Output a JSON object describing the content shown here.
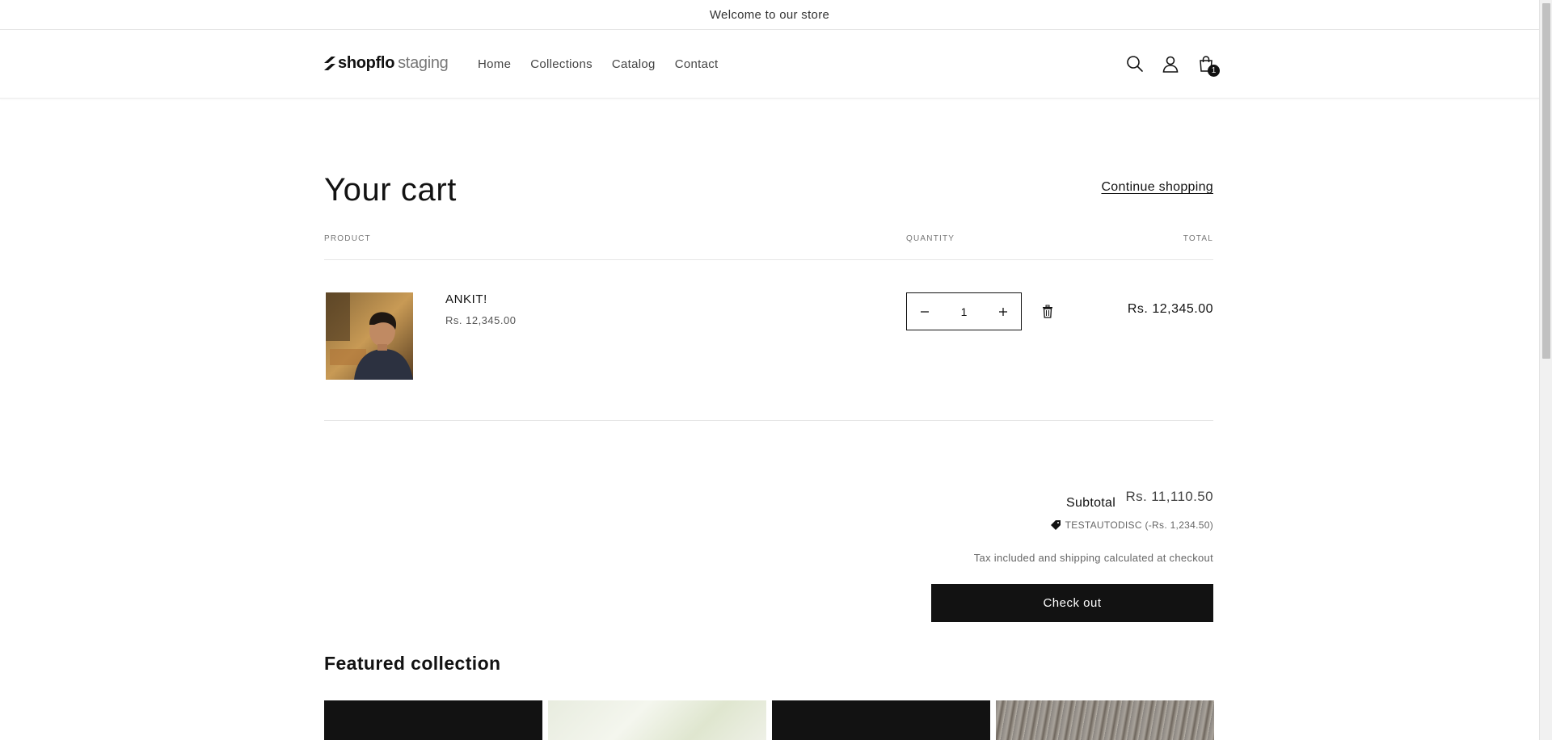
{
  "announcement": {
    "text": "Welcome to our store"
  },
  "header": {
    "logo_bold": "shopflo",
    "logo_light": "staging",
    "nav": [
      "Home",
      "Collections",
      "Catalog",
      "Contact"
    ],
    "cart_count": "1",
    "icons": [
      "search-icon",
      "account-icon",
      "cart-icon"
    ]
  },
  "cart": {
    "title": "Your cart",
    "continue_label": "Continue shopping",
    "columns": {
      "product": "PRODUCT",
      "quantity": "QUANTITY",
      "total": "TOTAL"
    },
    "items": [
      {
        "name": "ANKIT!",
        "price": "Rs. 12,345.00",
        "quantity": "1",
        "line_total": "Rs. 12,345.00"
      }
    ]
  },
  "summary": {
    "subtotal_label": "Subtotal",
    "subtotal_value": "Rs. 11,110.50",
    "discount": "TESTAUTODISC (-Rs. 1,234.50)",
    "tax_note": "Tax included and shipping calculated at checkout",
    "checkout_label": "Check out"
  },
  "featured": {
    "title": "Featured collection"
  },
  "colors": {
    "primary": "#121212",
    "text_muted": "#777777",
    "border": "#e6e6e6"
  }
}
